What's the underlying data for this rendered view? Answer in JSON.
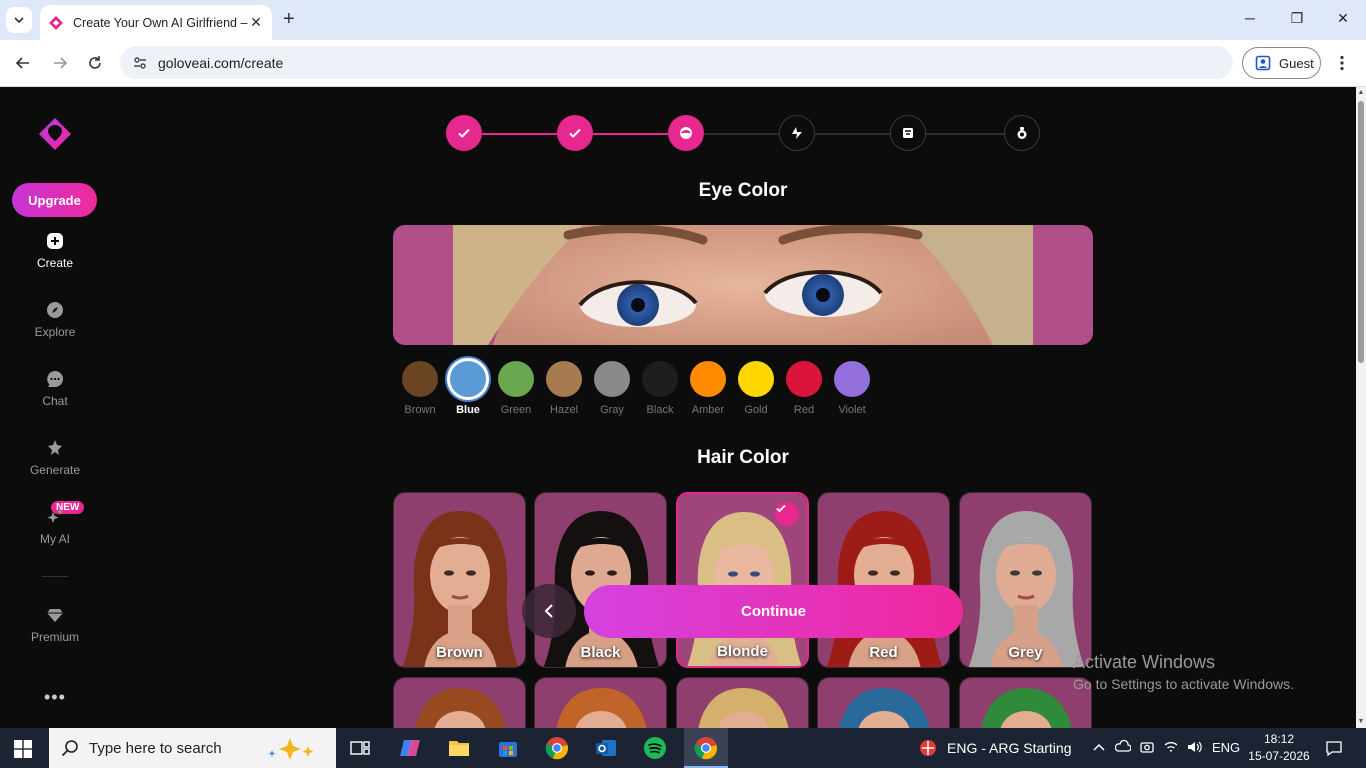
{
  "browser": {
    "tab_title": "Create Your Own AI Girlfriend –",
    "url": "goloveai.com/create",
    "profile_label": "Guest"
  },
  "sidebar": {
    "upgrade_label": "Upgrade",
    "items": [
      {
        "label": "Create",
        "icon": "plus-icon",
        "active": true
      },
      {
        "label": "Explore",
        "icon": "compass-icon",
        "active": false
      },
      {
        "label": "Chat",
        "icon": "chat-icon",
        "active": false
      },
      {
        "label": "Generate",
        "icon": "sparkle-icon",
        "active": false
      },
      {
        "label": "My AI",
        "icon": "stars-icon",
        "active": false
      },
      {
        "label": "Premium",
        "icon": "diamond-icon",
        "active": false
      }
    ],
    "new_badge": "NEW"
  },
  "stepper": {
    "steps": [
      {
        "state": "done",
        "icon": "check-icon"
      },
      {
        "state": "done",
        "icon": "check-icon"
      },
      {
        "state": "current",
        "icon": "face-icon"
      },
      {
        "state": "todo",
        "icon": "body-icon"
      },
      {
        "state": "todo",
        "icon": "outfit-icon"
      },
      {
        "state": "todo",
        "icon": "bag-icon"
      }
    ]
  },
  "eye_color": {
    "title": "Eye Color",
    "selected": "Blue",
    "options": [
      {
        "label": "Brown",
        "color": "#6b4423"
      },
      {
        "label": "Blue",
        "color": "#5b9bd5"
      },
      {
        "label": "Green",
        "color": "#6aa84f"
      },
      {
        "label": "Hazel",
        "color": "#a67b50"
      },
      {
        "label": "Gray",
        "color": "#8a8a8a"
      },
      {
        "label": "Black",
        "color": "#1e1e1e"
      },
      {
        "label": "Amber",
        "color": "#ff8c00"
      },
      {
        "label": "Gold",
        "color": "#ffd700"
      },
      {
        "label": "Red",
        "color": "#dc143c"
      },
      {
        "label": "Violet",
        "color": "#9370db"
      }
    ]
  },
  "hair_color": {
    "title": "Hair Color",
    "selected": "Blonde",
    "options": [
      {
        "label": "Brown",
        "color": "#7a3218"
      },
      {
        "label": "Black",
        "color": "#141010"
      },
      {
        "label": "Blonde",
        "color": "#d9bf86"
      },
      {
        "label": "Red",
        "color": "#9e1c18"
      },
      {
        "label": "Grey",
        "color": "#a8a8a8"
      }
    ],
    "next_row_colors": [
      "#9a4a20",
      "#c0642a",
      "#d4b06c",
      "#2a6a9a",
      "#2f8a3a"
    ]
  },
  "actions": {
    "continue_label": "Continue"
  },
  "watermark": {
    "line1": "Activate Windows",
    "line2": "Go to Settings to activate Windows."
  },
  "taskbar": {
    "search_placeholder": "Type here to search",
    "weather_text": "ENG - ARG Starting",
    "lang": "ENG",
    "time": "18:12",
    "date": "15-07-2026"
  },
  "colors": {
    "accent": "#e6288f",
    "background": "#0c0c0c"
  }
}
